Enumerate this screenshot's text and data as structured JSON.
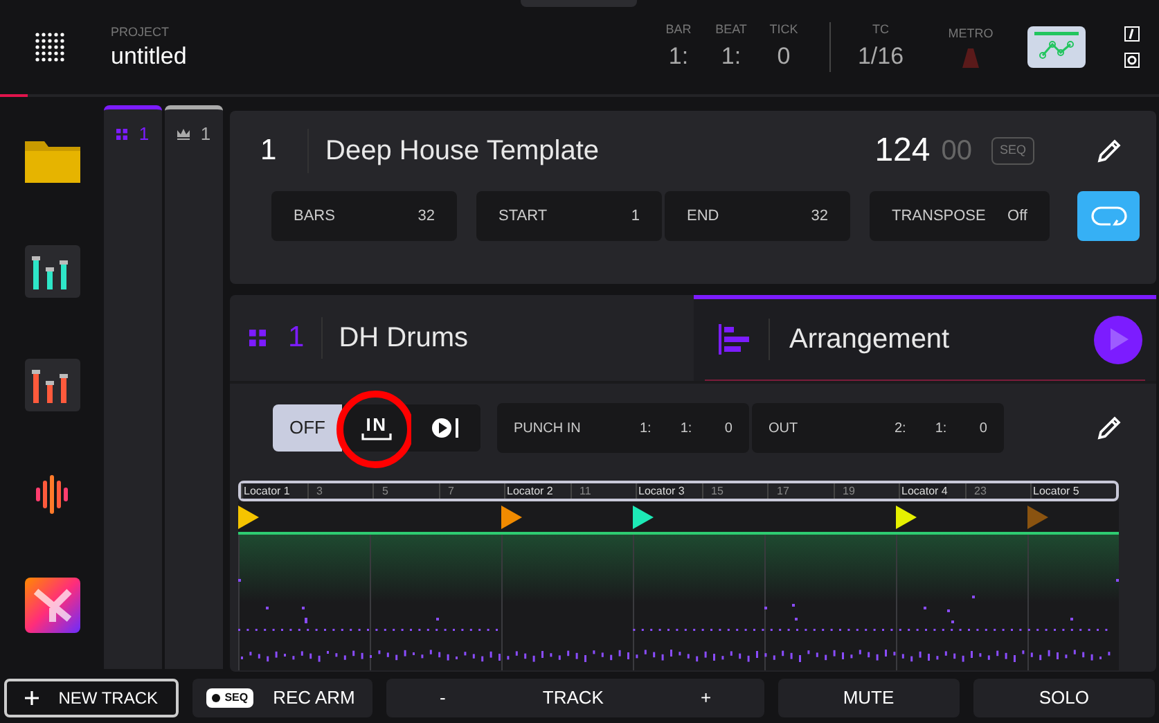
{
  "header": {
    "project_label": "PROJECT",
    "project_name": "untitled",
    "position": [
      {
        "label": "BAR",
        "value": "1:"
      },
      {
        "label": "BEAT",
        "value": "1:"
      },
      {
        "label": "TICK",
        "value": "0"
      }
    ],
    "tc_label": "TC",
    "tc_value": "1/16",
    "metro_label": "METRO",
    "metro_on": false
  },
  "sidebar": [
    {
      "kind": "browser"
    },
    {
      "kind": "mixer"
    },
    {
      "kind": "channel"
    },
    {
      "kind": "sampler"
    },
    {
      "kind": "xy"
    }
  ],
  "track_columns": [
    {
      "kind": "sequence",
      "number": "1",
      "selected": true
    },
    {
      "kind": "song",
      "number": "1",
      "selected": false
    }
  ],
  "sequence": {
    "number": "1",
    "name": "Deep House Template",
    "bpm": "124",
    "bpm_fraction": "00",
    "mode": "SEQ",
    "fields": [
      {
        "label": "BARS",
        "value": "32"
      },
      {
        "label": "START",
        "value": "1"
      },
      {
        "label": "END",
        "value": "32"
      },
      {
        "label": "TRANSPOSE",
        "value": "Off"
      }
    ],
    "loop_on": true
  },
  "track": {
    "number": "1",
    "name": "DH Drums"
  },
  "arrangement": {
    "title": "Arrangement",
    "selected": true
  },
  "record_modes": [
    {
      "kind": "off",
      "label": "OFF",
      "selected": true
    },
    {
      "kind": "in",
      "label": "IN",
      "selected": false,
      "highlighted": true
    },
    {
      "kind": "play",
      "selected": false
    }
  ],
  "punch": [
    {
      "label": "PUNCH IN",
      "values": [
        "1:",
        "1:",
        "0"
      ]
    },
    {
      "label": "OUT",
      "values": [
        "2:",
        "1:",
        "0"
      ]
    }
  ],
  "ruler": [
    {
      "kind": "locator",
      "label": "Locator 1",
      "color": "#f5c400"
    },
    {
      "kind": "bar",
      "label": "3"
    },
    {
      "kind": "bar",
      "label": "5"
    },
    {
      "kind": "bar",
      "label": "7"
    },
    {
      "kind": "locator",
      "label": "Locator 2",
      "color": "#f08a00"
    },
    {
      "kind": "bar",
      "label": "11"
    },
    {
      "kind": "locator",
      "label": "Locator 3",
      "color": "#1de9b6"
    },
    {
      "kind": "bar",
      "label": "15"
    },
    {
      "kind": "bar",
      "label": "17"
    },
    {
      "kind": "bar",
      "label": "19"
    },
    {
      "kind": "locator",
      "label": "Locator 4",
      "color": "#e6f000"
    },
    {
      "kind": "bar",
      "label": "23"
    },
    {
      "kind": "locator",
      "label": "Locator 5",
      "color": "#8a5310"
    }
  ],
  "bottom": [
    {
      "kind": "new",
      "label": "NEW TRACK"
    },
    {
      "kind": "rec",
      "badge": "SEQ",
      "label": "REC ARM"
    },
    {
      "kind": "track",
      "minus": "-",
      "label": "TRACK",
      "plus": "+"
    },
    {
      "kind": "plain",
      "label": "MUTE"
    },
    {
      "kind": "plain",
      "label": "SOLO"
    }
  ]
}
